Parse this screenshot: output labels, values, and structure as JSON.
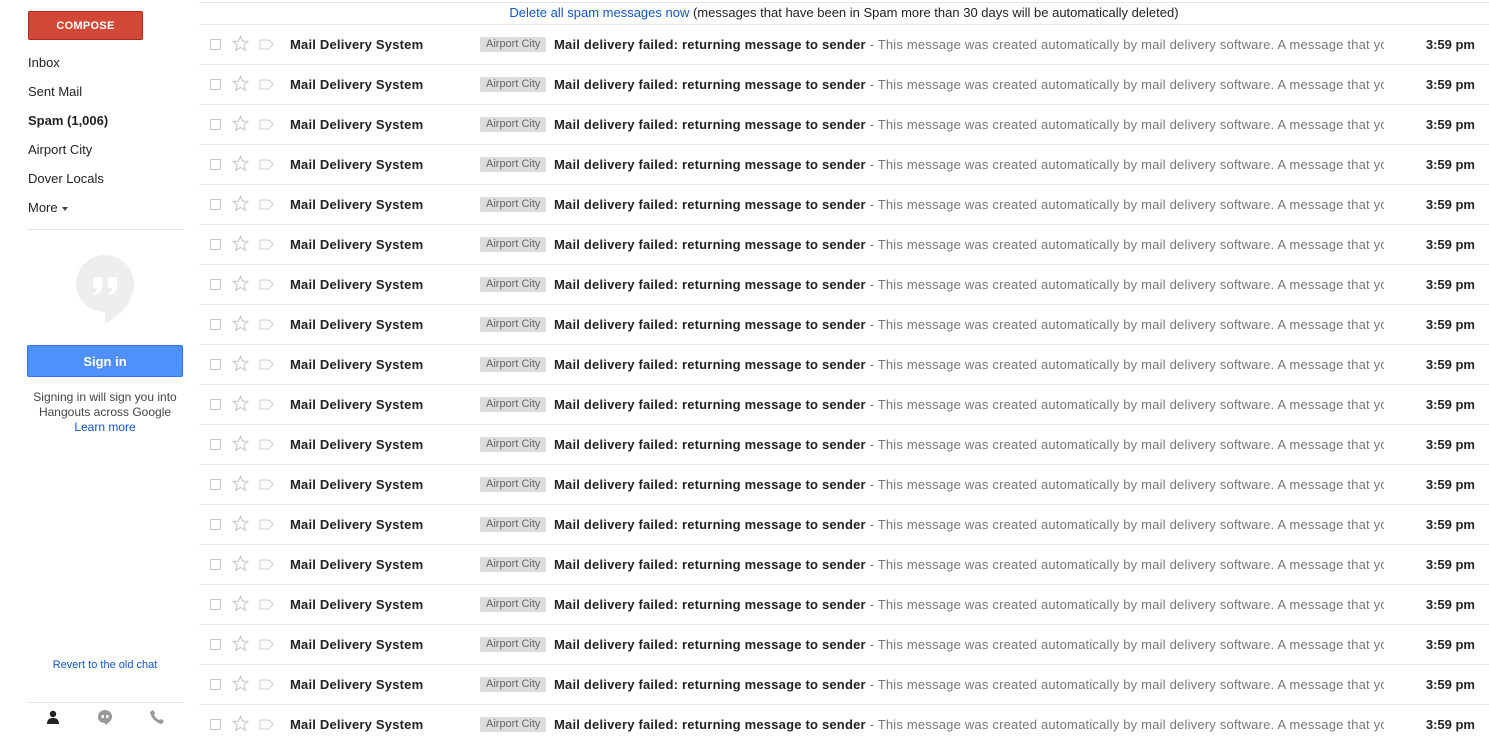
{
  "sidebar": {
    "compose_label": "COMPOSE",
    "nav_items": [
      {
        "label": "Inbox",
        "active": false
      },
      {
        "label": "Sent Mail",
        "active": false
      },
      {
        "label": "Spam (1,006)",
        "active": true
      },
      {
        "label": "Airport City",
        "active": false
      },
      {
        "label": "Dover Locals",
        "active": false
      },
      {
        "label": "More",
        "active": false
      }
    ],
    "hangouts": {
      "signin_label": "Sign in",
      "note": "Signing in will sign you into Hangouts across Google",
      "learn_more": "Learn more",
      "revert_link": "Revert to the old chat",
      "tabs": [
        "person-icon",
        "hangouts-icon",
        "phone-icon"
      ]
    }
  },
  "spam_banner": {
    "link": "Delete all spam messages now",
    "text": " (messages that have been in Spam more than 30 days will be automatically deleted)"
  },
  "messages": [
    {
      "sender": "Mail Delivery System",
      "label": "Airport City",
      "subject": "Mail delivery failed: returning message to sender",
      "snippet": " - This message was created automatically by mail delivery software. A message that you",
      "time": "3:59 pm"
    },
    {
      "sender": "Mail Delivery System",
      "label": "Airport City",
      "subject": "Mail delivery failed: returning message to sender",
      "snippet": " - This message was created automatically by mail delivery software. A message that you",
      "time": "3:59 pm"
    },
    {
      "sender": "Mail Delivery System",
      "label": "Airport City",
      "subject": "Mail delivery failed: returning message to sender",
      "snippet": " - This message was created automatically by mail delivery software. A message that you",
      "time": "3:59 pm"
    },
    {
      "sender": "Mail Delivery System",
      "label": "Airport City",
      "subject": "Mail delivery failed: returning message to sender",
      "snippet": " - This message was created automatically by mail delivery software. A message that you",
      "time": "3:59 pm"
    },
    {
      "sender": "Mail Delivery System",
      "label": "Airport City",
      "subject": "Mail delivery failed: returning message to sender",
      "snippet": " - This message was created automatically by mail delivery software. A message that you",
      "time": "3:59 pm"
    },
    {
      "sender": "Mail Delivery System",
      "label": "Airport City",
      "subject": "Mail delivery failed: returning message to sender",
      "snippet": " - This message was created automatically by mail delivery software. A message that you",
      "time": "3:59 pm"
    },
    {
      "sender": "Mail Delivery System",
      "label": "Airport City",
      "subject": "Mail delivery failed: returning message to sender",
      "snippet": " - This message was created automatically by mail delivery software. A message that you",
      "time": "3:59 pm"
    },
    {
      "sender": "Mail Delivery System",
      "label": "Airport City",
      "subject": "Mail delivery failed: returning message to sender",
      "snippet": " - This message was created automatically by mail delivery software. A message that you",
      "time": "3:59 pm"
    },
    {
      "sender": "Mail Delivery System",
      "label": "Airport City",
      "subject": "Mail delivery failed: returning message to sender",
      "snippet": " - This message was created automatically by mail delivery software. A message that you",
      "time": "3:59 pm"
    },
    {
      "sender": "Mail Delivery System",
      "label": "Airport City",
      "subject": "Mail delivery failed: returning message to sender",
      "snippet": " - This message was created automatically by mail delivery software. A message that you",
      "time": "3:59 pm"
    },
    {
      "sender": "Mail Delivery System",
      "label": "Airport City",
      "subject": "Mail delivery failed: returning message to sender",
      "snippet": " - This message was created automatically by mail delivery software. A message that you",
      "time": "3:59 pm"
    },
    {
      "sender": "Mail Delivery System",
      "label": "Airport City",
      "subject": "Mail delivery failed: returning message to sender",
      "snippet": " - This message was created automatically by mail delivery software. A message that you",
      "time": "3:59 pm"
    },
    {
      "sender": "Mail Delivery System",
      "label": "Airport City",
      "subject": "Mail delivery failed: returning message to sender",
      "snippet": " - This message was created automatically by mail delivery software. A message that you",
      "time": "3:59 pm"
    },
    {
      "sender": "Mail Delivery System",
      "label": "Airport City",
      "subject": "Mail delivery failed: returning message to sender",
      "snippet": " - This message was created automatically by mail delivery software. A message that you",
      "time": "3:59 pm"
    },
    {
      "sender": "Mail Delivery System",
      "label": "Airport City",
      "subject": "Mail delivery failed: returning message to sender",
      "snippet": " - This message was created automatically by mail delivery software. A message that you",
      "time": "3:59 pm"
    },
    {
      "sender": "Mail Delivery System",
      "label": "Airport City",
      "subject": "Mail delivery failed: returning message to sender",
      "snippet": " - This message was created automatically by mail delivery software. A message that you",
      "time": "3:59 pm"
    },
    {
      "sender": "Mail Delivery System",
      "label": "Airport City",
      "subject": "Mail delivery failed: returning message to sender",
      "snippet": " - This message was created automatically by mail delivery software. A message that you",
      "time": "3:59 pm"
    },
    {
      "sender": "Mail Delivery System",
      "label": "Airport City",
      "subject": "Mail delivery failed: returning message to sender",
      "snippet": " - This message was created automatically by mail delivery software. A message that you",
      "time": "3:59 pm"
    }
  ],
  "colors": {
    "compose": "#d14836",
    "signin": "#4d90fe",
    "link": "#1155cc",
    "label_chip": "#dddddd"
  }
}
